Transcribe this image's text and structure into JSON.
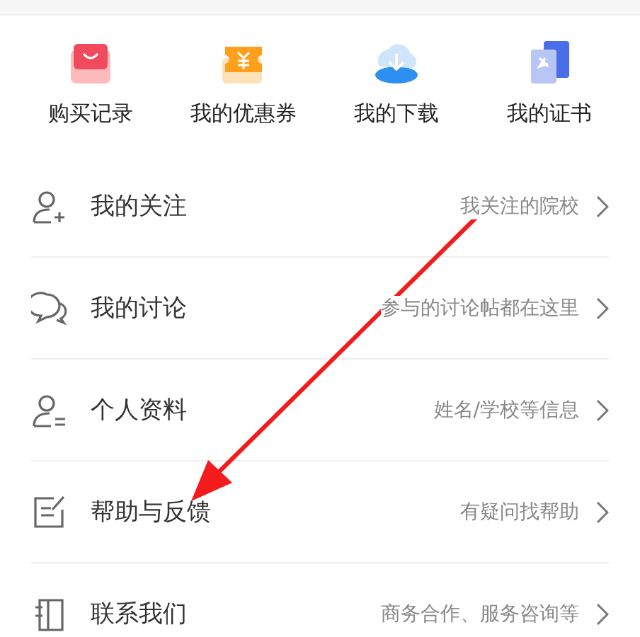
{
  "shortcuts": [
    {
      "kind": "bag",
      "label": "购买记录"
    },
    {
      "kind": "coupon",
      "label": "我的优惠券"
    },
    {
      "kind": "download",
      "label": "我的下载"
    },
    {
      "kind": "certificate",
      "label": "我的证书"
    }
  ],
  "menu": [
    {
      "kind": "follow",
      "title": "我的关注",
      "hint": "我关注的院校"
    },
    {
      "kind": "discussion",
      "title": "我的讨论",
      "hint": "参与的讨论帖都在这里"
    },
    {
      "kind": "profile",
      "title": "个人资料",
      "hint": "姓名/学校等信息"
    },
    {
      "kind": "feedback",
      "title": "帮助与反馈",
      "hint": "有疑问找帮助"
    },
    {
      "kind": "contact",
      "title": "联系我们",
      "hint": "商务合作、服务咨询等"
    }
  ]
}
